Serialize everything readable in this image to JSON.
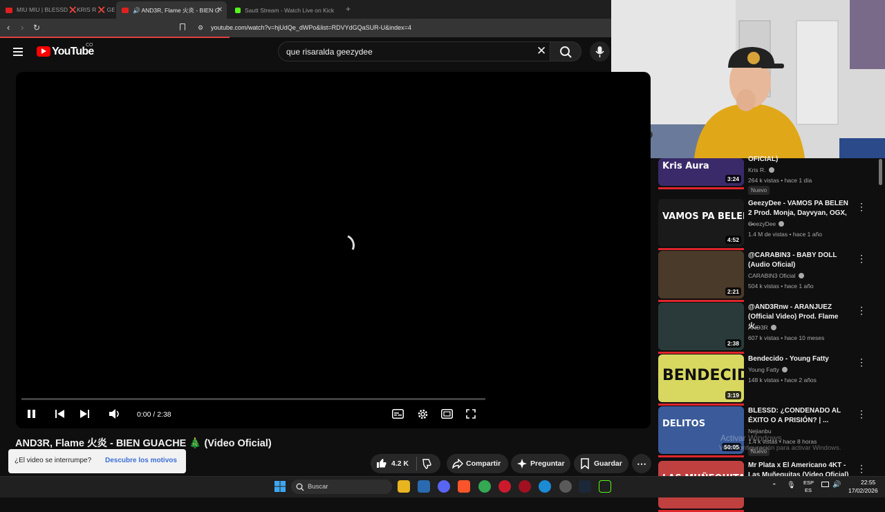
{
  "browser": {
    "tabs": [
      {
        "label": "MIU MIU | BLESSD ❌KRIS R ❌ GE",
        "favicon_color": "#e02020",
        "active": false
      },
      {
        "label": "🔊 AND3R, Flame 火炎 - BIEN G",
        "favicon_color": "#e02020",
        "active": true
      },
      {
        "label": "Sautt Stream - Watch Live on Kick",
        "favicon_color": "#53fc18",
        "active": false
      }
    ],
    "new_tab_icon": "plus-icon",
    "url": "youtube.com/watch?v=hjUdQe_dWPo&list=RDVYdGQaSUR-U&index=4"
  },
  "youtube": {
    "logo_text": "YouTube",
    "logo_country": "CO",
    "search_query": "que risaralda geezydee",
    "accent": "#ff0000"
  },
  "player": {
    "time": "0:00 / 2:38",
    "state": "buffering",
    "progress_fraction": 0.0
  },
  "video": {
    "title": "AND3R, Flame 火炎 - BIEN GUACHE 🎄 (Video Oficial)",
    "likes": "4.2 K",
    "share_label": "Compartir",
    "ask_label": "Preguntar",
    "save_label": "Guardar"
  },
  "toast": {
    "question": "¿El video se interrumpe?",
    "link": "Descubre los motivos"
  },
  "sidebar": [
    {
      "title": "OFICIAL)",
      "channel": "Kris R.",
      "meta": "264 k vistas • hace 1 día",
      "duration": "3:24",
      "new": "Nuevo",
      "thumb_color": "#3a2a6a",
      "thumb_text": "Kris Aura"
    },
    {
      "title": "GeezyDee - VAMOS PA BELEN 2 Prod. Monja, Dayvyan, OGX, ...",
      "channel": "GeezyDee",
      "meta": "1.4 M de vistas • hace 1 año",
      "duration": "4:52",
      "thumb_color": "#1a1a1a",
      "thumb_text": "VAMOS PA BELEN"
    },
    {
      "title": "@CARABIN3 - BABY DOLL (Audio Oficial)",
      "channel": "CARABIN3 Oficial",
      "meta": "504 k vistas • hace 1 año",
      "duration": "2:21",
      "thumb_color": "#4a3a2a",
      "thumb_text": ""
    },
    {
      "title": "@AND3Rnw - ARANJUEZ (Official Video) Prod. Flame 火...",
      "channel": "AND3R",
      "meta": "607 k vistas • hace 10 meses",
      "duration": "2:38",
      "thumb_color": "#2a3a3a",
      "thumb_text": ""
    },
    {
      "title": "Bendecido - Young Fatty",
      "channel": "Young Fatty",
      "meta": "148 k vistas • hace 2 años",
      "duration": "3:19",
      "thumb_color": "#d8d860",
      "thumb_text": "BENDECIDO"
    },
    {
      "title": "BLESSD: ¿CONDENADO AL ÉXITO O A PRISIÓN? | ...",
      "channel": "Nejianbu",
      "meta": "1.4 k vistas • hace 8 horas",
      "duration": "50:05",
      "new": "Nuevo",
      "thumb_color": "#3a5a9a",
      "thumb_text": "DELITOS"
    },
    {
      "title": "Mr Plata x El Americano 4KT - Las Muñequitas (Video Oficial)",
      "channel": "",
      "meta": "",
      "duration": "",
      "thumb_color": "#c04040",
      "thumb_text": "LAS MUÑEQUITAS"
    }
  ],
  "watermark": {
    "line1": "Activar Windows",
    "line2": "Ve a Configuración para activar Windows."
  },
  "taskbar": {
    "search_placeholder": "Buscar",
    "lang_top": "ESP",
    "lang_bottom": "ES",
    "time": "22:55",
    "date": "17/02/2026"
  }
}
